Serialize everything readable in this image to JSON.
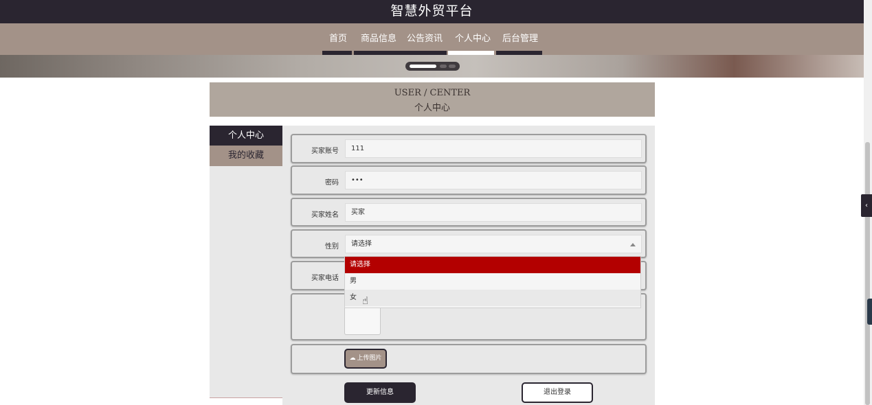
{
  "site": {
    "title": "智慧外贸平台"
  },
  "nav": {
    "items": [
      {
        "label": "首页",
        "active": false
      },
      {
        "label": "商品信息",
        "active": false
      },
      {
        "label": "公告资讯",
        "active": false
      },
      {
        "label": "个人中心",
        "active": true
      },
      {
        "label": "后台管理",
        "active": false
      }
    ]
  },
  "section": {
    "title_en": "USER / CENTER",
    "title_cn": "个人中心"
  },
  "sidebar": {
    "items": [
      {
        "label": "个人中心",
        "active": true
      },
      {
        "label": "我的收藏",
        "active": false
      }
    ]
  },
  "form": {
    "account": {
      "label": "买家账号",
      "value": "111"
    },
    "password": {
      "label": "密码",
      "value": "•••"
    },
    "name": {
      "label": "买家姓名",
      "value": "买家"
    },
    "gender": {
      "label": "性别",
      "value": "请选择",
      "options": [
        "请选择",
        "男",
        "女"
      ],
      "highlighted_index": 0,
      "hover_index": 2
    },
    "phone": {
      "label": "买家电话"
    },
    "upload_label": "上传图片"
  },
  "buttons": {
    "update": "更新信息",
    "logout": "退出登录"
  },
  "colors": {
    "dark": "#2a2530",
    "accent": "#a39288",
    "selected": "#b30000",
    "header_band": "#b0a69d"
  },
  "icons": {
    "upload": "cloud-upload-icon",
    "side_tab": "chevron-left-icon",
    "cursor": "hand-pointer-icon"
  }
}
